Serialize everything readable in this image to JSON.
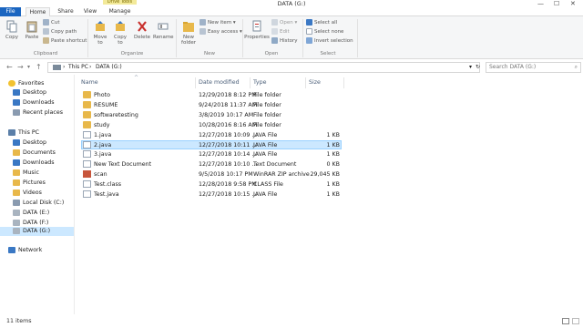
{
  "window": {
    "title": "DATA (G:)",
    "context_tab": "Drive Tools",
    "controls": [
      "—",
      "☐",
      "✕"
    ]
  },
  "tabs": [
    {
      "label": "File"
    },
    {
      "label": "Home"
    },
    {
      "label": "Share"
    },
    {
      "label": "View"
    },
    {
      "label": "Manage"
    }
  ],
  "ribbon": {
    "clipboard": {
      "copy": "Copy",
      "paste": "Paste",
      "cut": "Cut",
      "copy_path": "Copy path",
      "paste_shortcut": "Paste shortcut",
      "group": "Clipboard"
    },
    "organize": {
      "move_to": "Move to",
      "copy_to": "Copy to",
      "delete": "Delete",
      "rename": "Rename",
      "group": "Organize"
    },
    "new": {
      "new_folder": "New folder",
      "new_item": "New item ▾",
      "easy_access": "Easy access ▾",
      "group": "New"
    },
    "open": {
      "properties": "Properties",
      "open": "Open ▾",
      "edit": "Edit",
      "history": "History",
      "group": "Open"
    },
    "select": {
      "select_all": "Select all",
      "select_none": "Select none",
      "invert_selection": "Invert selection",
      "group": "Select"
    }
  },
  "address": {
    "path_1": "This PC",
    "path_2": "DATA (G:)",
    "search_placeholder": "Search DATA (G:)"
  },
  "nav": {
    "favorites": "Favorites",
    "desktop": "Desktop",
    "downloads": "Downloads",
    "recent": "Recent places",
    "this_pc": "This PC",
    "pc_desktop": "Desktop",
    "documents": "Documents",
    "pc_downloads": "Downloads",
    "music": "Music",
    "pictures": "Pictures",
    "videos": "Videos",
    "local_disk": "Local Disk (C:)",
    "data_e": "DATA (E:)",
    "data_f": "DATA (F:)",
    "data_g": "DATA (G:)",
    "network": "Network"
  },
  "columns": {
    "name": "Name",
    "date": "Date modified",
    "type": "Type",
    "size": "Size"
  },
  "files": [
    {
      "name": "Photo",
      "date": "12/29/2018 8:12 PM",
      "type": "File folder",
      "size": ""
    },
    {
      "name": "RESUME",
      "date": "9/24/2018 11:37 AM",
      "type": "File folder",
      "size": ""
    },
    {
      "name": "softwaretesting",
      "date": "3/8/2019 10:17 AM",
      "type": "File folder",
      "size": ""
    },
    {
      "name": "study",
      "date": "10/28/2016 8:16 AM",
      "type": "File folder",
      "size": ""
    },
    {
      "name": "1.java",
      "date": "12/27/2018 10:09 ...",
      "type": "JAVA File",
      "size": "1 KB"
    },
    {
      "name": "2.java",
      "date": "12/27/2018 10:11 ...",
      "type": "JAVA File",
      "size": "1 KB"
    },
    {
      "name": "3.java",
      "date": "12/27/2018 10:14 ...",
      "type": "JAVA File",
      "size": "1 KB"
    },
    {
      "name": "New Text Document",
      "date": "12/27/2018 10:10 ...",
      "type": "Text Document",
      "size": "0 KB"
    },
    {
      "name": "scan",
      "date": "9/5/2018 10:17 PM",
      "type": "WinRAR ZIP archive",
      "size": "29,045 KB"
    },
    {
      "name": "Test.class",
      "date": "12/28/2018 9:58 PM",
      "type": "CLASS File",
      "size": "1 KB"
    },
    {
      "name": "Test.java",
      "date": "12/27/2018 10:15 ...",
      "type": "JAVA File",
      "size": "1 KB"
    }
  ],
  "status": {
    "count": "11 items"
  },
  "colors": {
    "accent": "#1a65c0",
    "selection": "#cce8ff",
    "folder": "#e8b84a"
  }
}
